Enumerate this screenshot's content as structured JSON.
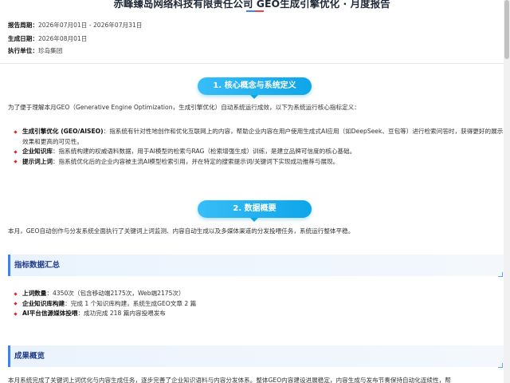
{
  "header": {
    "title": "赤峰臻岛网络科技有限责任公司 GEO生成引擎优化 · 月度报告"
  },
  "meta": [
    {
      "key": "报告周期：",
      "value": "2026年07月01日 - 2026年07月31日"
    },
    {
      "key": "生成日期：",
      "value": "2026年08月01日"
    },
    {
      "key": "执行单位：",
      "value": "珍岛集团"
    }
  ],
  "section1": {
    "title": "1. 核心概念与系统定义",
    "intro": "为了便于理解本月GEO（Generative Engine Optimization，生成引擎优化）自动系统运行成效，以下为系统运行核心指标定义：",
    "items": [
      {
        "key": "生成引擎优化 (GEO/AISEO)",
        "text": "：指系统有针对性地创作和优化互联网上的内容，帮助企业内容在用户使用生成式AI应用（如DeepSeek、豆包等）进行检索问答时，获得更好的展示效果和更高的可见性。"
      },
      {
        "key": "企业知识库",
        "text": "：指系统构建的权威语料数据，用于AI模型的检索与RAG（检索增强生成）训练，是建立品牌可信度的核心基础。"
      },
      {
        "key": "提示词上词",
        "text": "：指系统优化后的企业内容被主流AI模型检索引用，并在特定的搜索提示词/关键词下实现成功推荐与展现。"
      }
    ]
  },
  "section2": {
    "title": "2. 数据概要",
    "intro": "本月，GEO自动创作与分发系统全面执行了关键词上词监测、内容自动生成以及多媒体渠道的分发投喂任务，系统运行整体平稳。",
    "metrics_heading": "指标数据汇总",
    "metrics": [
      {
        "key": "上词数量",
        "text": "：4350次（包含移动端2175次，Web端2175次）"
      },
      {
        "key": "企业知识库构建",
        "text": "：完成 1 个知识库构建，系统生成GEO文章 2 篇"
      },
      {
        "key": "AI平台信源媒体投喂",
        "text": "：成功完成 218 篇内容投喂发布"
      }
    ],
    "overview_heading": "成果概览",
    "overview_text": "本月系统完成了关键词上词优化与内容生成任务，逐步完善了企业知识语料与内容分发体系。整体GEO内容建设进展稳定，内容生成与发布节奏保持自动化连续性，帮"
  },
  "colors": {
    "accent": "#0ea5e9",
    "bullet": "#dc2626",
    "subhead_border": "#3b82f6"
  }
}
